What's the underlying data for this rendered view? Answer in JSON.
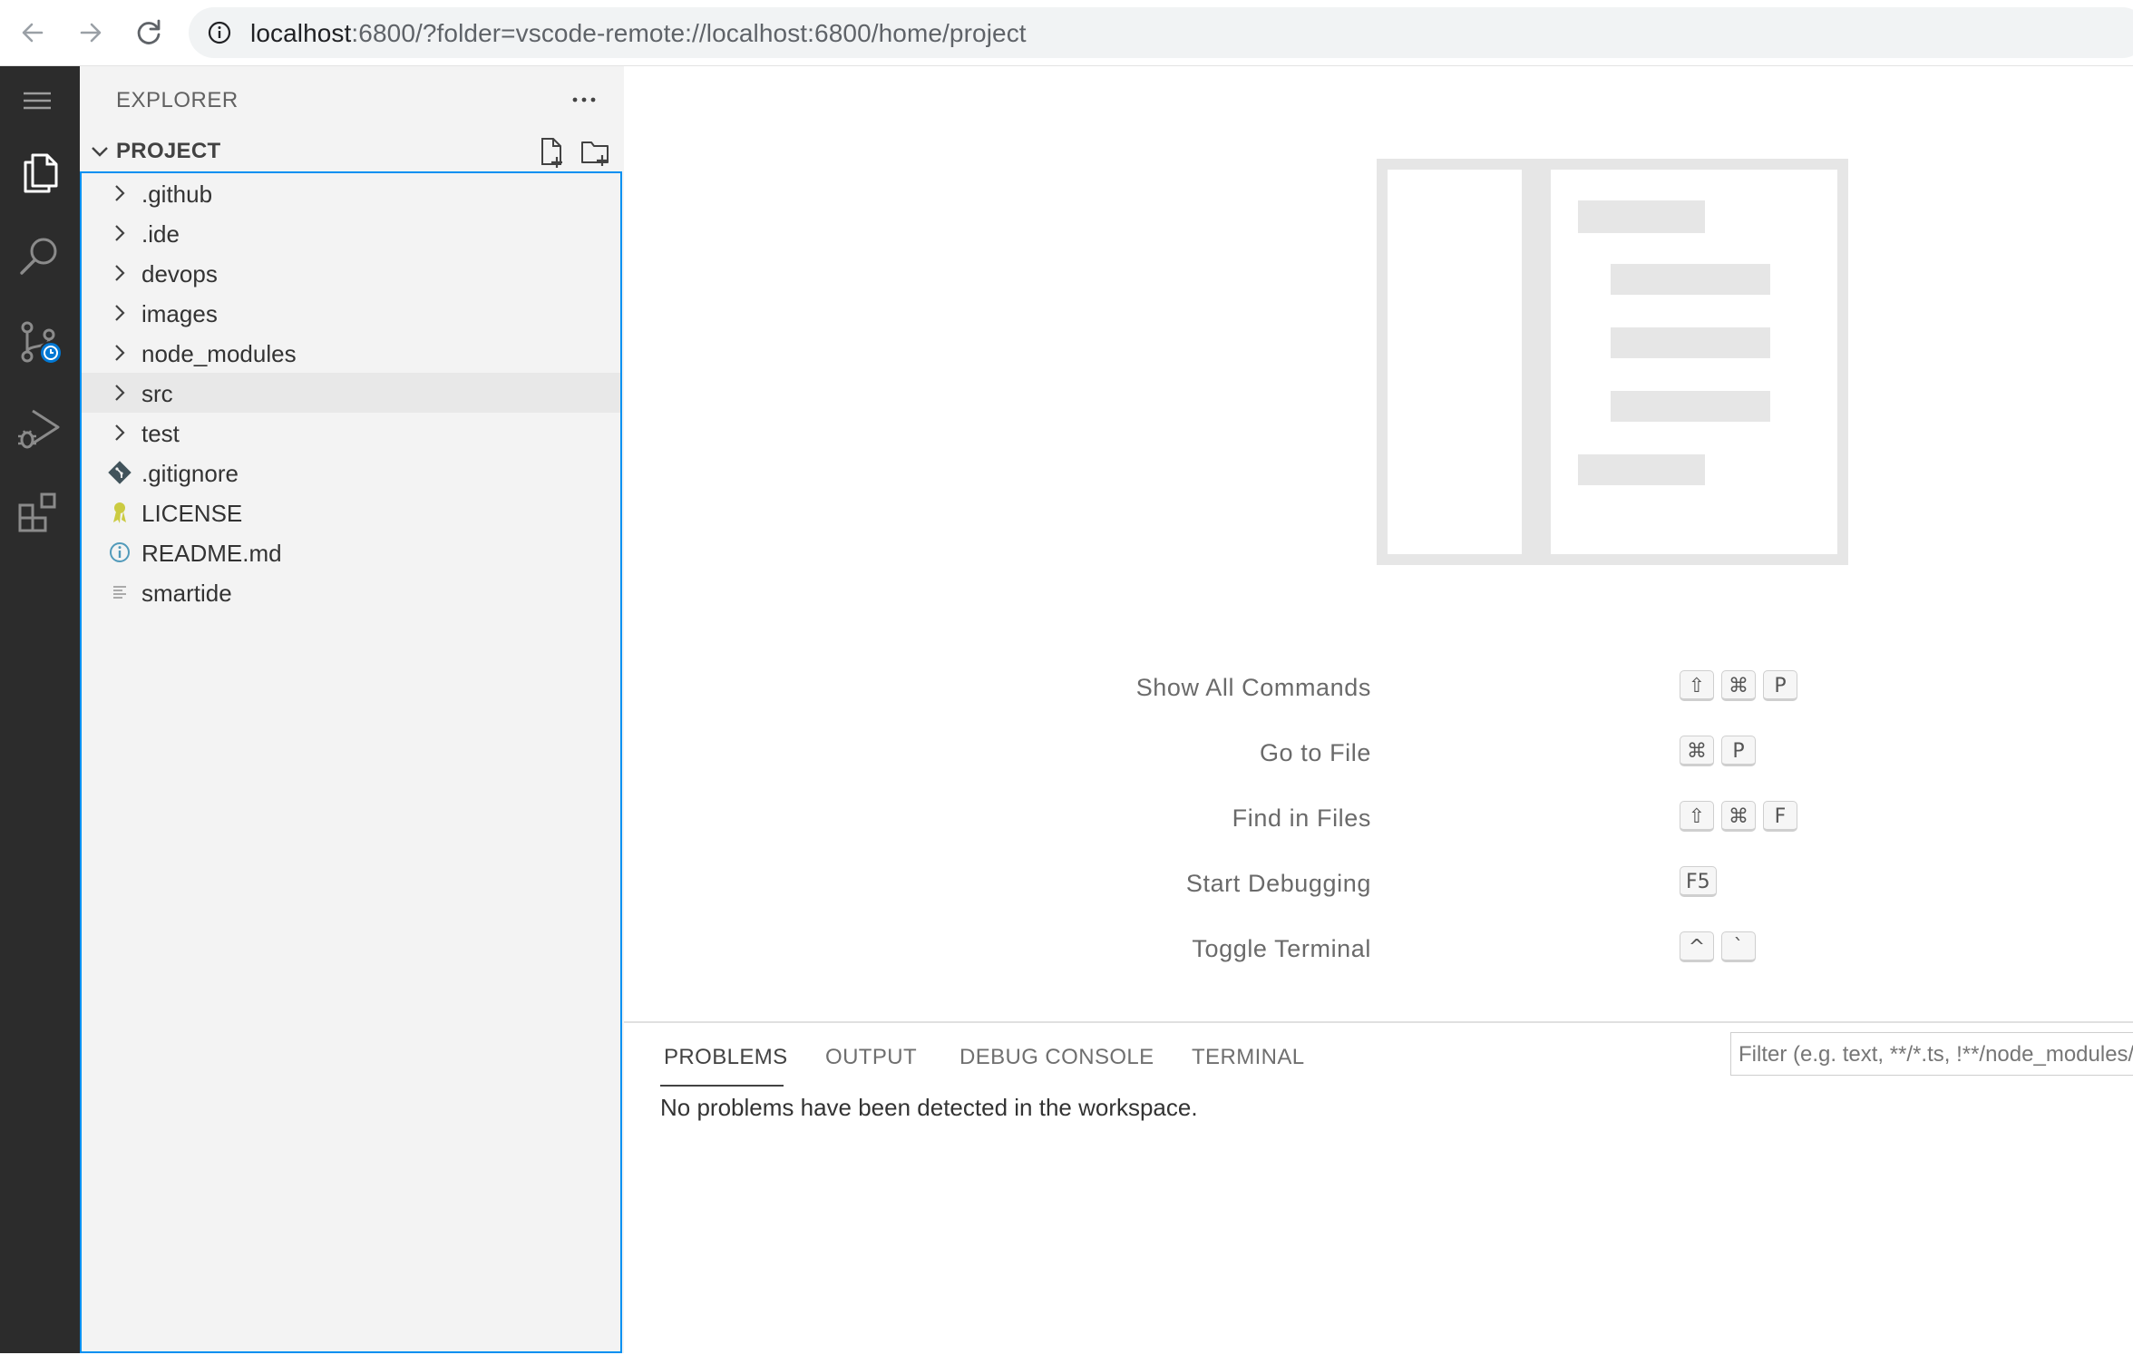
{
  "browser": {
    "url_host": "localhost",
    "url_rest": ":6800/?folder=vscode-remote://localhost:6800/home/project"
  },
  "activity_bar": {
    "items": [
      "explorer-icon",
      "search-icon",
      "source-control-icon",
      "run-debug-icon",
      "extensions-icon"
    ]
  },
  "sidebar": {
    "title": "EXPLORER",
    "section": "PROJECT",
    "items": [
      {
        "label": ".github",
        "kind": "folder"
      },
      {
        "label": ".ide",
        "kind": "folder"
      },
      {
        "label": "devops",
        "kind": "folder"
      },
      {
        "label": "images",
        "kind": "folder"
      },
      {
        "label": "node_modules",
        "kind": "folder"
      },
      {
        "label": "src",
        "kind": "folder",
        "selected": true
      },
      {
        "label": "test",
        "kind": "folder"
      },
      {
        "label": ".gitignore",
        "kind": "git-file"
      },
      {
        "label": "LICENSE",
        "kind": "license-file"
      },
      {
        "label": "README.md",
        "kind": "info-file"
      },
      {
        "label": "smartide",
        "kind": "text-file"
      }
    ]
  },
  "editor": {
    "shortcuts": [
      {
        "label": "Show All Commands",
        "keys": [
          "⇧",
          "⌘",
          "P"
        ]
      },
      {
        "label": "Go to File",
        "keys": [
          "⌘",
          "P"
        ]
      },
      {
        "label": "Find in Files",
        "keys": [
          "⇧",
          "⌘",
          "F"
        ]
      },
      {
        "label": "Start Debugging",
        "keys": [
          "F5"
        ]
      },
      {
        "label": "Toggle Terminal",
        "keys": [
          "^",
          "`"
        ]
      }
    ]
  },
  "panel": {
    "tabs": [
      "PROBLEMS",
      "OUTPUT",
      "DEBUG CONSOLE",
      "TERMINAL"
    ],
    "active_tab": "PROBLEMS",
    "filter_placeholder": "Filter (e.g. text, **/*.ts, !**/node_modules/**)",
    "message": "No problems have been detected in the workspace."
  },
  "colors": {
    "activity_bar": "#2c2c2c",
    "sidebar": "#f3f3f3",
    "focus_border": "#0090f1",
    "badge": "#0078d4"
  }
}
